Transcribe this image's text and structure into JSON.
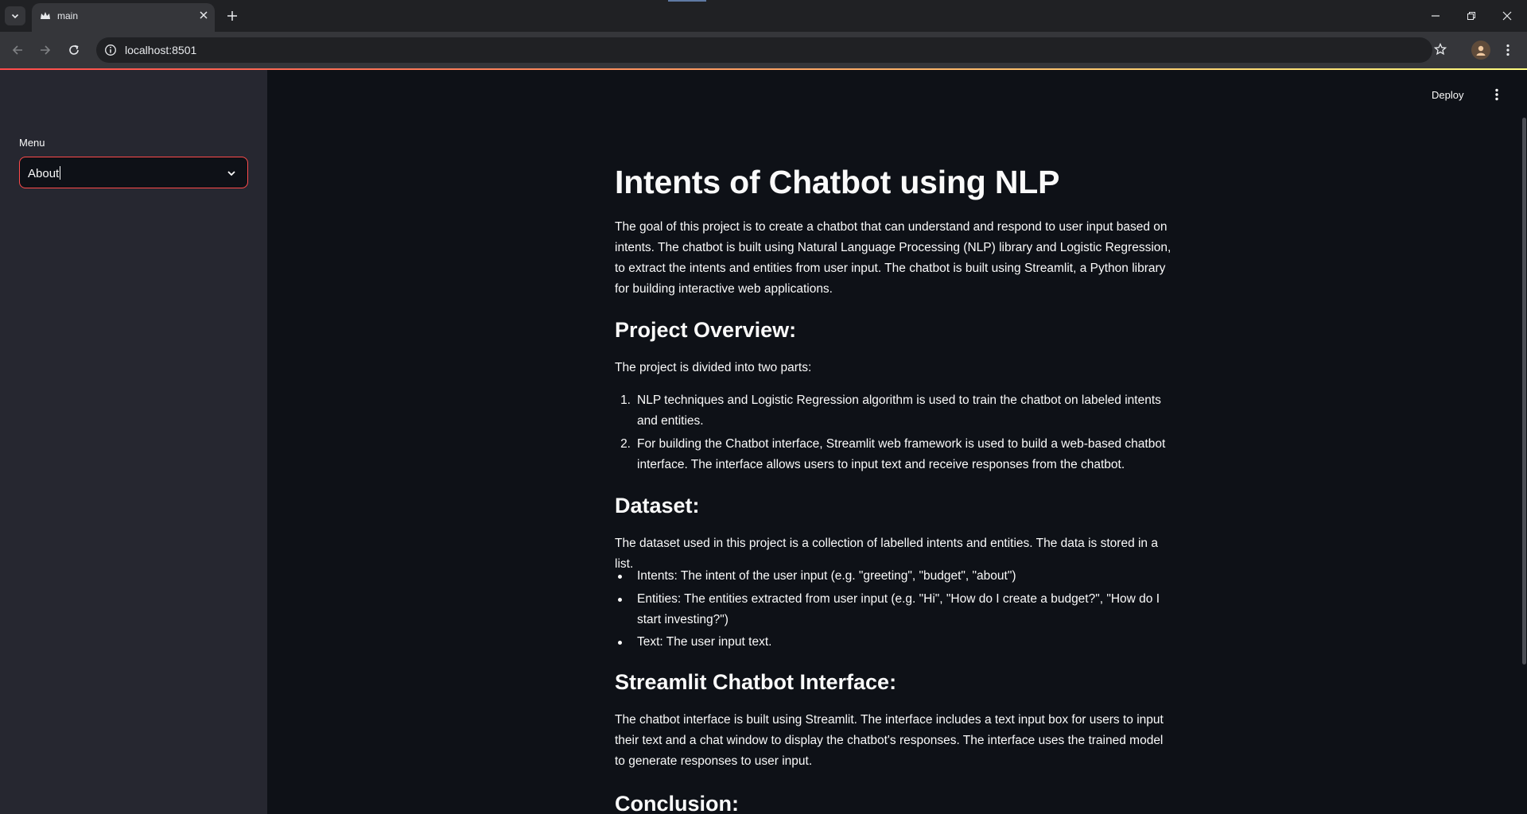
{
  "browser": {
    "tab_title": "main",
    "url": "localhost:8501"
  },
  "sidebar": {
    "menu_label": "Menu",
    "selected": "About"
  },
  "header": {
    "deploy_label": "Deploy"
  },
  "content": {
    "title": "Intents of Chatbot using NLP",
    "intro": "The goal of this project is to create a chatbot that can understand and respond to user input based on intents. The chatbot is built using Natural Language Processing (NLP) library and Logistic Regression, to extract the intents and entities from user input. The chatbot is built using Streamlit, a Python library for building interactive web applications.",
    "overview_heading": "Project Overview:",
    "overview_text": "The project is divided into two parts:",
    "overview_items": [
      {
        "marker": "1.",
        "text": "NLP techniques and Logistic Regression algorithm is used to train the chatbot on labeled intents and entities."
      },
      {
        "marker": "2.",
        "text": "For building the Chatbot interface, Streamlit web framework is used to build a web-based chatbot interface. The interface allows users to input text and receive responses from the chatbot."
      }
    ],
    "dataset_heading": "Dataset:",
    "dataset_text": "The dataset used in this project is a collection of labelled intents and entities. The data is stored in a list.",
    "dataset_items": [
      "Intents: The intent of the user input (e.g. \"greeting\", \"budget\", \"about\")",
      "Entities: The entities extracted from user input (e.g. \"Hi\", \"How do I create a budget?\", \"How do I start investing?\")",
      "Text: The user input text."
    ],
    "interface_heading": "Streamlit Chatbot Interface:",
    "interface_text": "The chatbot interface is built using Streamlit. The interface includes a text input box for users to input their text and a chat window to display the chatbot's responses. The interface uses the trained model to generate responses to user input.",
    "conclusion_heading": "Conclusion:"
  },
  "colors": {
    "accent": "#ff4b4b",
    "background": "#0e1117",
    "sidebar": "#262730"
  }
}
